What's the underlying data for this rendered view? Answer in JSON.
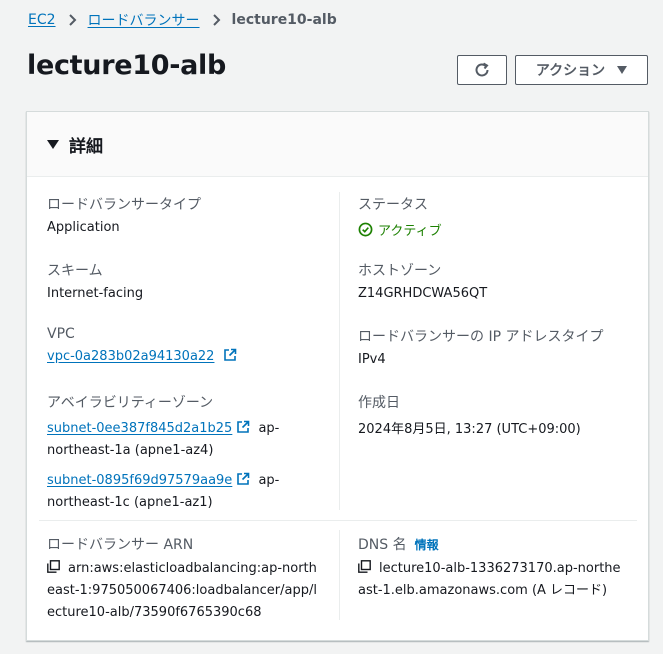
{
  "breadcrumb": {
    "root": "EC2",
    "parent": "ロードバランサー",
    "current": "lecture10-alb"
  },
  "page": {
    "title": "lecture10-alb"
  },
  "actions": {
    "label": "アクション"
  },
  "panel": {
    "title": "詳細",
    "lb_type": {
      "label": "ロードバランサータイプ",
      "value": "Application"
    },
    "status": {
      "label": "ステータス",
      "value": "アクティブ"
    },
    "scheme": {
      "label": "スキーム",
      "value": "Internet-facing"
    },
    "hosted_zone": {
      "label": "ホストゾーン",
      "value": "Z14GRHDCWA56QT"
    },
    "vpc": {
      "label": "VPC",
      "value": "vpc-0a283b02a94130a22"
    },
    "ip_type": {
      "label": "ロードバランサーの IP アドレスタイプ",
      "value": "IPv4"
    },
    "az": {
      "label": "アベイラビリティーゾーン",
      "subnets": [
        {
          "id": "subnet-0ee387f845d2a1b25",
          "suffix": "ap-",
          "zone": "northeast-1a (apne1-az4)"
        },
        {
          "id": "subnet-0895f69d97579aa9e",
          "suffix": "ap-",
          "zone": "northeast-1c (apne1-az1)"
        }
      ]
    },
    "created": {
      "label": "作成日",
      "value": "2024年8月5日, 13:27 (UTC+09:00)"
    },
    "arn": {
      "label": "ロードバランサー ARN",
      "lines": [
        "arn:aws:elasticloadbalancing:ap-north",
        "east-1:975050067406:loadbalancer/app/l",
        "ecture10-alb/73590f6765390c68"
      ]
    },
    "dns": {
      "label": "DNS 名",
      "info": "情報",
      "lines": [
        "lecture10-alb-1336273170.ap-northe",
        "ast-1.elb.amazonaws.com (A レコード)"
      ]
    }
  }
}
